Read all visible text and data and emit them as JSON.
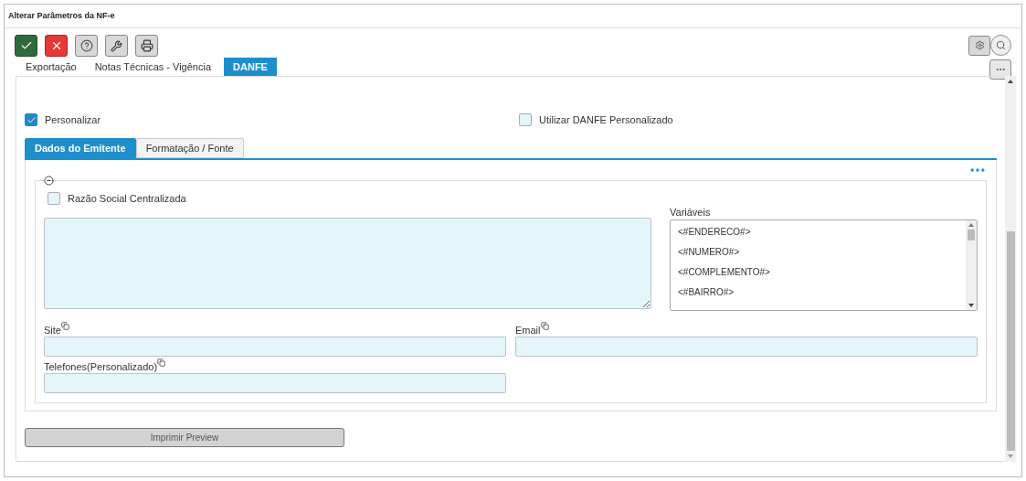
{
  "window": {
    "title": "Alterar Parâmetros da NF-e"
  },
  "toolbar": [
    {
      "kind": "confirm"
    },
    {
      "kind": "cancel"
    },
    {
      "kind": "help"
    },
    {
      "kind": "tools"
    },
    {
      "kind": "print"
    }
  ],
  "tabs": [
    {
      "label": "Exportação",
      "selected": false
    },
    {
      "label": "Notas Técnicas - Vigência",
      "selected": false
    },
    {
      "label": "DANFE",
      "selected": true
    }
  ],
  "options": [
    {
      "label": "Personalizar",
      "checked": true
    },
    {
      "label": "Utilizar DANFE Personalizado",
      "checked": false
    }
  ],
  "subtabs": [
    {
      "label": "Dados do Emitente",
      "selected": true
    },
    {
      "label": "Formatação / Fonte",
      "selected": false
    }
  ],
  "group": {
    "expanded": true,
    "checkbox": {
      "label": "Razão Social Centralizada",
      "checked": false
    },
    "variables": {
      "label": "Variáveis",
      "items": [
        "<#ENDERECO#>",
        "<#NUMERO#>",
        "<#COMPLEMENTO#>",
        "<#BAIRRO#>"
      ]
    },
    "fields": [
      {
        "label": "Site"
      },
      {
        "label": "Email"
      },
      {
        "label": "Telefones(Personalizado)"
      }
    ]
  },
  "preview_button": "Imprimir Preview"
}
